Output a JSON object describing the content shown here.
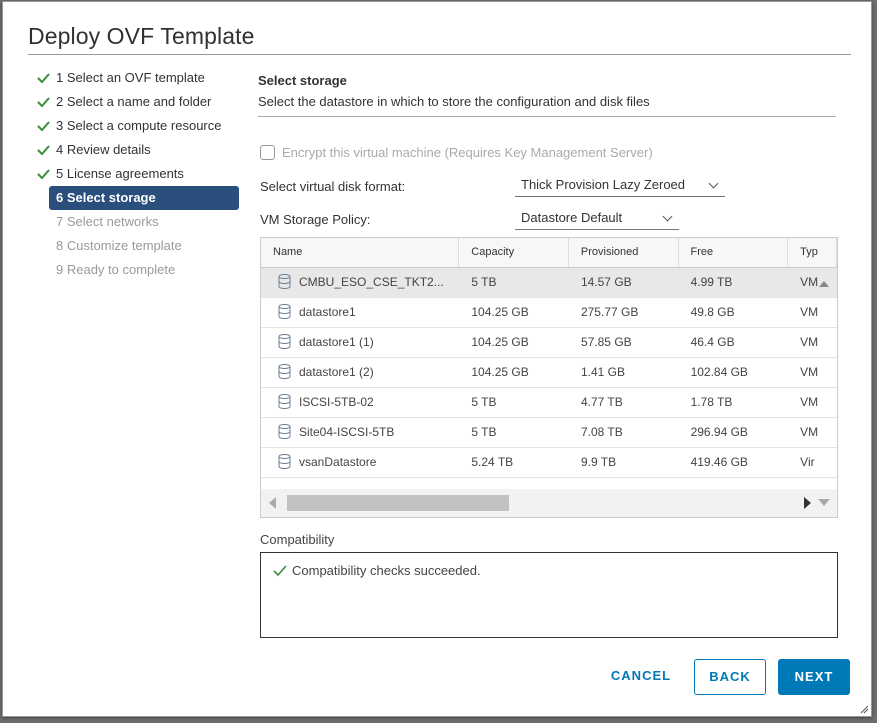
{
  "dialog": {
    "title": "Deploy OVF Template"
  },
  "steps": [
    {
      "label": "1 Select an OVF template",
      "state": "done"
    },
    {
      "label": "2 Select a name and folder",
      "state": "done"
    },
    {
      "label": "3 Select a compute resource",
      "state": "done"
    },
    {
      "label": "4 Review details",
      "state": "done"
    },
    {
      "label": "5 License agreements",
      "state": "done"
    },
    {
      "label": "6 Select storage",
      "state": "active"
    },
    {
      "label": "7 Select networks",
      "state": "pending"
    },
    {
      "label": "8 Customize template",
      "state": "pending"
    },
    {
      "label": "9 Ready to complete",
      "state": "pending"
    }
  ],
  "main": {
    "title": "Select storage",
    "subtitle": "Select the datastore in which to store the configuration and disk files",
    "encrypt_label": "Encrypt this virtual machine (Requires Key Management Server)",
    "disk_format_label": "Select virtual disk format:",
    "disk_format_value": "Thick Provision Lazy Zeroed",
    "policy_label": "VM Storage Policy:",
    "policy_value": "Datastore Default"
  },
  "grid": {
    "columns": [
      "Name",
      "Capacity",
      "Provisioned",
      "Free",
      "Typ"
    ],
    "rows": [
      {
        "name": "CMBU_ESO_CSE_TKT2...",
        "capacity": "5 TB",
        "provisioned": "14.57 GB",
        "free": "4.99 TB",
        "type": "VM"
      },
      {
        "name": "datastore1",
        "capacity": "104.25 GB",
        "provisioned": "275.77 GB",
        "free": "49.8 GB",
        "type": "VM"
      },
      {
        "name": "datastore1 (1)",
        "capacity": "104.25 GB",
        "provisioned": "57.85 GB",
        "free": "46.4 GB",
        "type": "VM"
      },
      {
        "name": "datastore1 (2)",
        "capacity": "104.25 GB",
        "provisioned": "1.41 GB",
        "free": "102.84 GB",
        "type": "VM"
      },
      {
        "name": "ISCSI-5TB-02",
        "capacity": "5 TB",
        "provisioned": "4.77 TB",
        "free": "1.78 TB",
        "type": "VM"
      },
      {
        "name": "Site04-ISCSI-5TB",
        "capacity": "5 TB",
        "provisioned": "7.08 TB",
        "free": "296.94 GB",
        "type": "VM"
      },
      {
        "name": "vsanDatastore",
        "capacity": "5.24 TB",
        "provisioned": "9.9 TB",
        "free": "419.46 GB",
        "type": "Vir"
      }
    ]
  },
  "compatibility": {
    "label": "Compatibility",
    "message": "Compatibility checks succeeded."
  },
  "buttons": {
    "cancel": "CANCEL",
    "back": "BACK",
    "next": "NEXT"
  },
  "colors": {
    "accent": "#0079b8",
    "active_step": "#2b4f7d",
    "check": "#3c8c3c"
  }
}
